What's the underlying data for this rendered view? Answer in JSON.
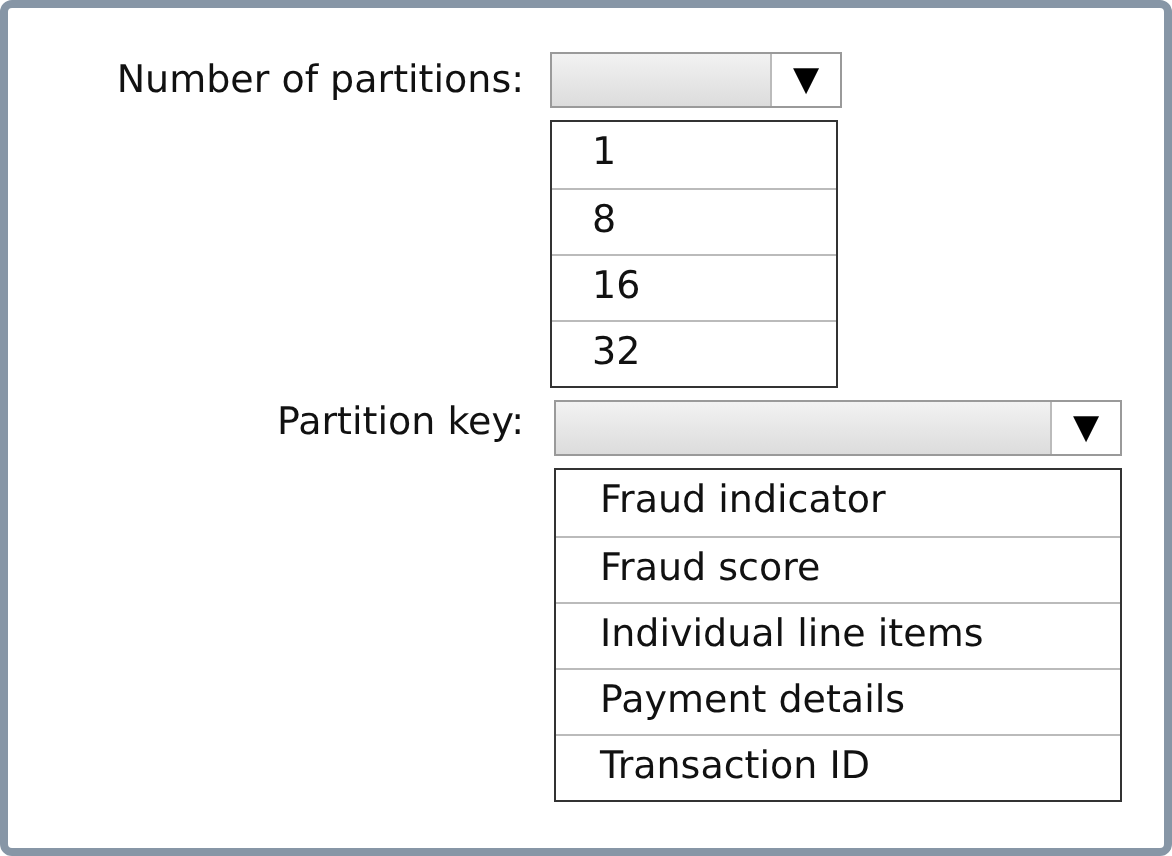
{
  "dropdowns": [
    {
      "label": "Number of partitions:",
      "arrow": "▼",
      "options": [
        "1",
        "8",
        "16",
        "32"
      ]
    },
    {
      "label": "Partition key:",
      "arrow": "▼",
      "options": [
        "Fraud indicator",
        "Fraud score",
        "Individual line items",
        "Payment details",
        "Transaction ID"
      ]
    }
  ]
}
